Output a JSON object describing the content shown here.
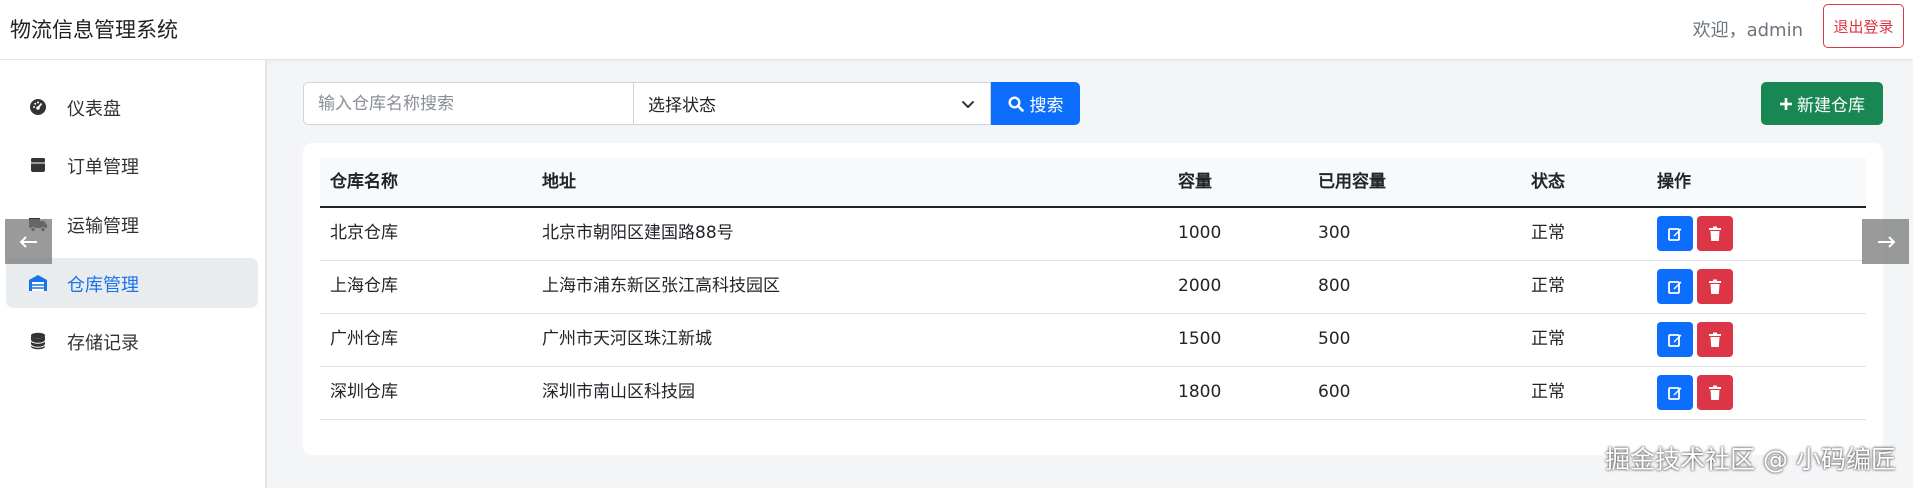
{
  "header": {
    "app_title": "物流信息管理系统",
    "welcome_text": "欢迎，admin",
    "logout_label": "退出登录"
  },
  "sidebar": {
    "items": [
      {
        "label": "仪表盘",
        "icon": "dashboard-icon",
        "active": false
      },
      {
        "label": "订单管理",
        "icon": "box-icon",
        "active": false
      },
      {
        "label": "运输管理",
        "icon": "truck-icon",
        "active": false
      },
      {
        "label": "仓库管理",
        "icon": "warehouse-icon",
        "active": true
      },
      {
        "label": "存储记录",
        "icon": "database-icon",
        "active": false
      }
    ]
  },
  "toolbar": {
    "search_placeholder": "输入仓库名称搜索",
    "status_select_value": "选择状态",
    "search_label": "搜索",
    "new_label": "新建仓库"
  },
  "table": {
    "columns": [
      "仓库名称",
      "地址",
      "容量",
      "已用容量",
      "状态",
      "操作"
    ],
    "rows": [
      {
        "name": "北京仓库",
        "address": "北京市朝阳区建国路88号",
        "capacity": "1000",
        "used": "300",
        "status": "正常"
      },
      {
        "name": "上海仓库",
        "address": "上海市浦东新区张江高科技园区",
        "capacity": "2000",
        "used": "800",
        "status": "正常"
      },
      {
        "name": "广州仓库",
        "address": "广州市天河区珠江新城",
        "capacity": "1500",
        "used": "500",
        "status": "正常"
      },
      {
        "name": "深圳仓库",
        "address": "深圳市南山区科技园",
        "capacity": "1800",
        "used": "600",
        "status": "正常"
      }
    ]
  },
  "watermark": "掘金技术社区 @ 小码编匠",
  "colors": {
    "primary": "#0d6efd",
    "success": "#198754",
    "danger": "#dc3545",
    "active_nav": "#1a73e8"
  }
}
